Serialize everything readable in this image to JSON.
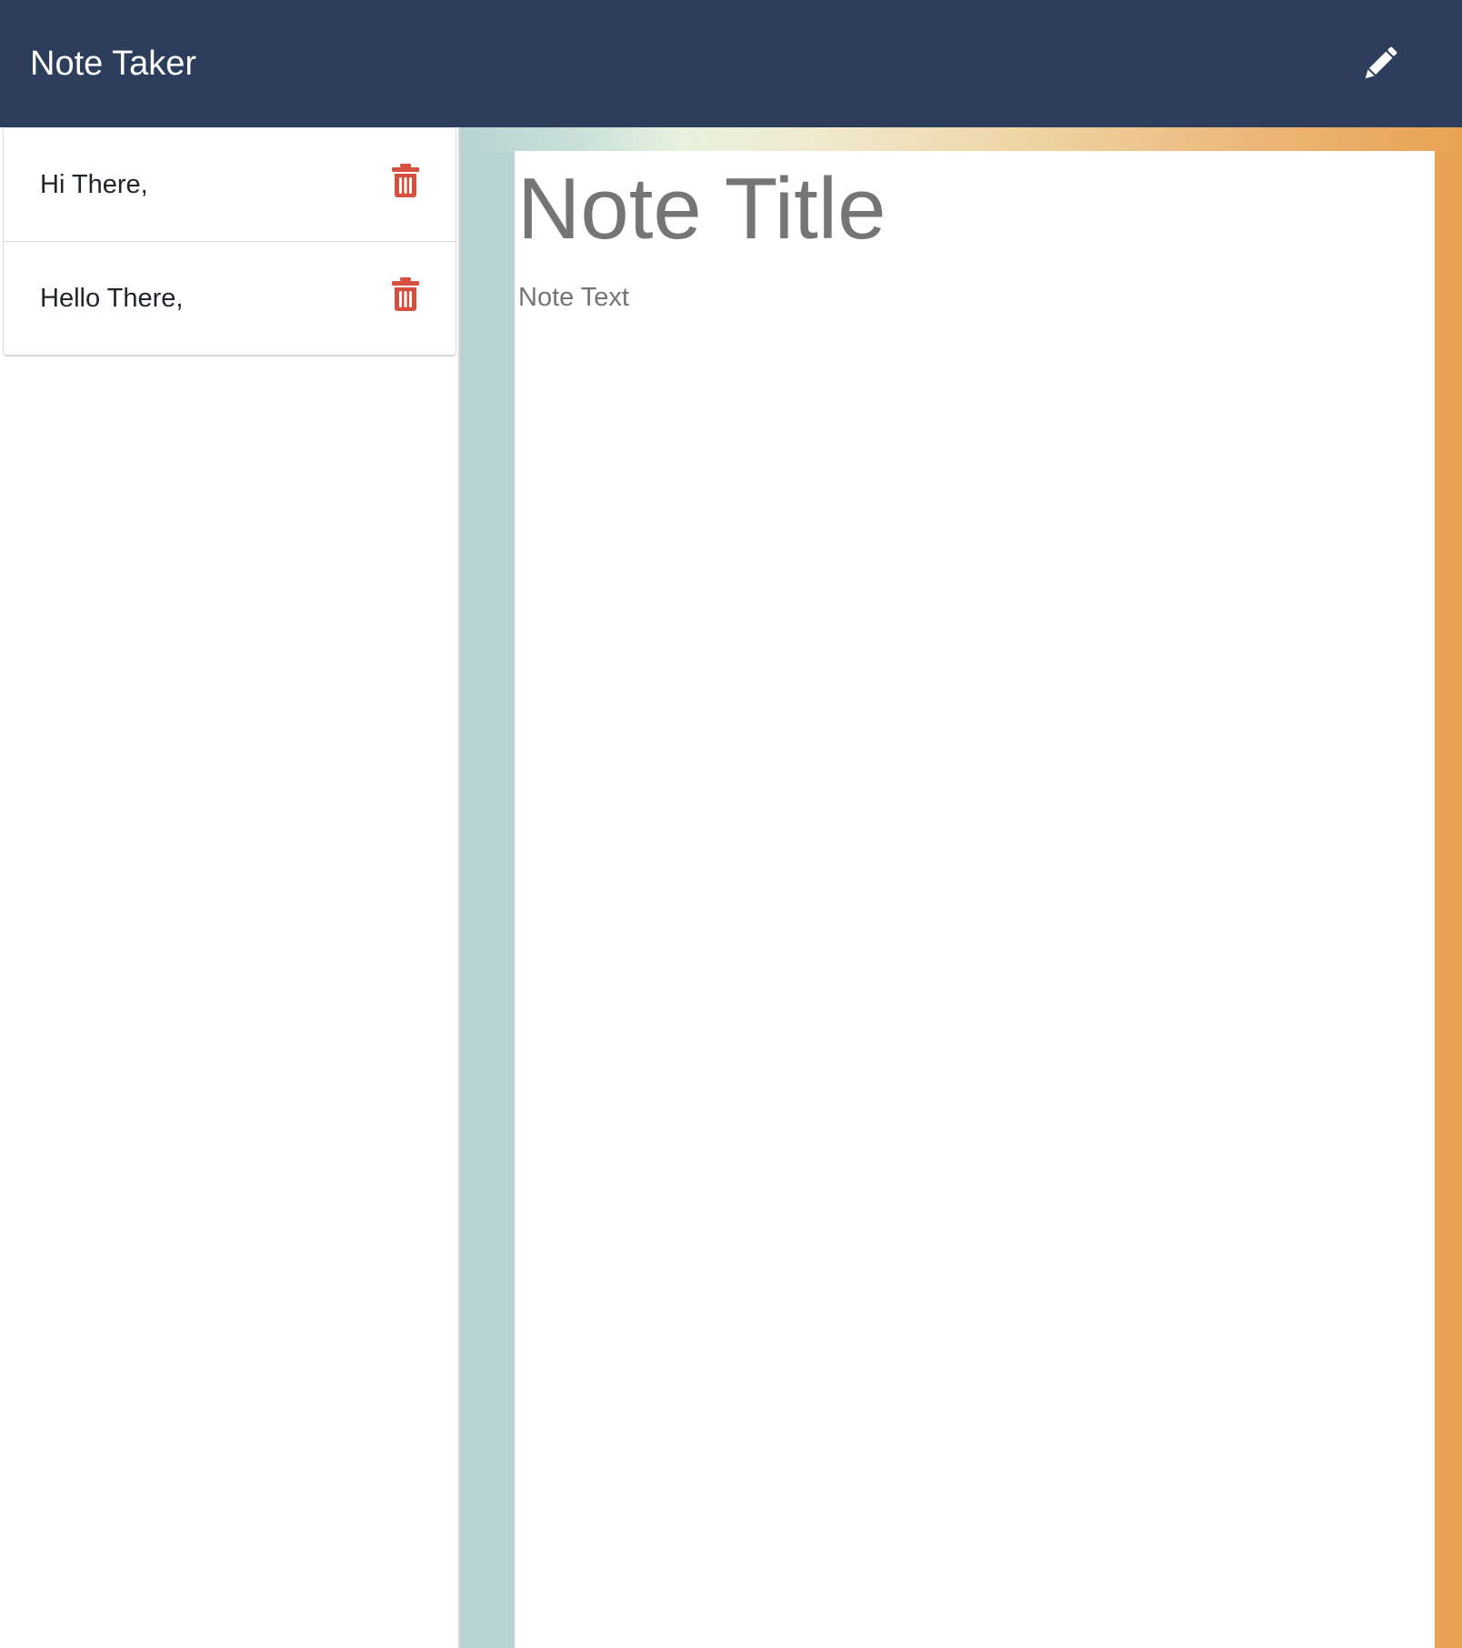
{
  "navbar": {
    "brand": "Note Taker",
    "new_note_icon": "pencil-icon",
    "background_color": "#2d3e5c"
  },
  "notes": [
    {
      "title": "Hi There,",
      "delete_icon": "trash-icon"
    },
    {
      "title": "Hello There,",
      "delete_icon": "trash-icon"
    }
  ],
  "editor": {
    "title_placeholder": "Note Title",
    "text_placeholder": "Note Text"
  },
  "colors": {
    "delete": "#d5503f",
    "placeholder": "#757575",
    "gradient_start": "#b8d4d1",
    "gradient_end": "#e9a253"
  }
}
